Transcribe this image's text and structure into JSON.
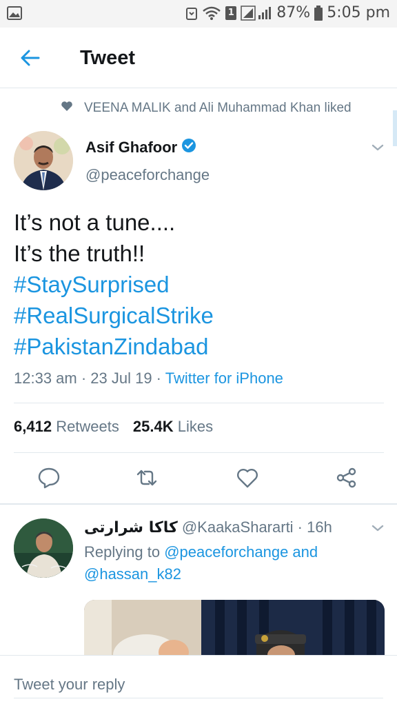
{
  "status_bar": {
    "battery": "87%",
    "time": "5:05 pm",
    "sim": "1"
  },
  "header": {
    "title": "Tweet"
  },
  "social_context": {
    "text": "VEENA MALIK and Ali Muhammad Khan liked"
  },
  "tweet": {
    "author_name": "Asif Ghafoor",
    "author_handle": "@peaceforchange",
    "text_lines": [
      "It’s not a tune....",
      "It’s the truth!!"
    ],
    "hashtags": [
      "#StaySurprised",
      "#RealSurgicalStrike",
      "#PakistanZindabad"
    ],
    "timestamp": "12:33 am · 23 Jul 19 · ",
    "source": "Twitter for iPhone",
    "retweets_count": "6,412",
    "retweets_label": "Retweets",
    "likes_count": "25.4K",
    "likes_label": "Likes"
  },
  "reply": {
    "display_name": "کاکا شرارتی",
    "handle_time": "@KaakaShararti · 16h",
    "replying_to_label": "Replying to ",
    "mention_1": "@peaceforchange",
    "and_label": " and",
    "mention_2": "@hassan_k82"
  },
  "reply_bar": {
    "placeholder": "Tweet your reply"
  },
  "colors": {
    "accent": "#1b95e0",
    "muted": "#657786",
    "text": "#14171a",
    "divider": "#e1e8ed"
  }
}
